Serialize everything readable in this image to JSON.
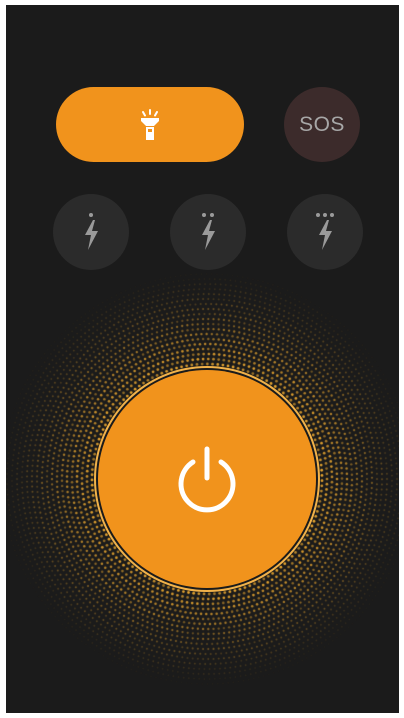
{
  "colors": {
    "background": "#1b1b1b",
    "accent": "#f1931c",
    "sos_bg": "#3c2b2b",
    "button_bg": "#2b2b2b",
    "icon_muted": "#9a9a9a",
    "dots": "#e8a630"
  },
  "top_row": {
    "flashlight_mode_icon": "flashlight-icon",
    "sos_label": "SOS"
  },
  "strobe_buttons": [
    {
      "icon": "lightning-one-dot-icon",
      "dots": 1
    },
    {
      "icon": "lightning-two-dots-icon",
      "dots": 2
    },
    {
      "icon": "lightning-three-dots-icon",
      "dots": 3
    }
  ],
  "power_button": {
    "icon": "power-icon",
    "state": "on"
  }
}
